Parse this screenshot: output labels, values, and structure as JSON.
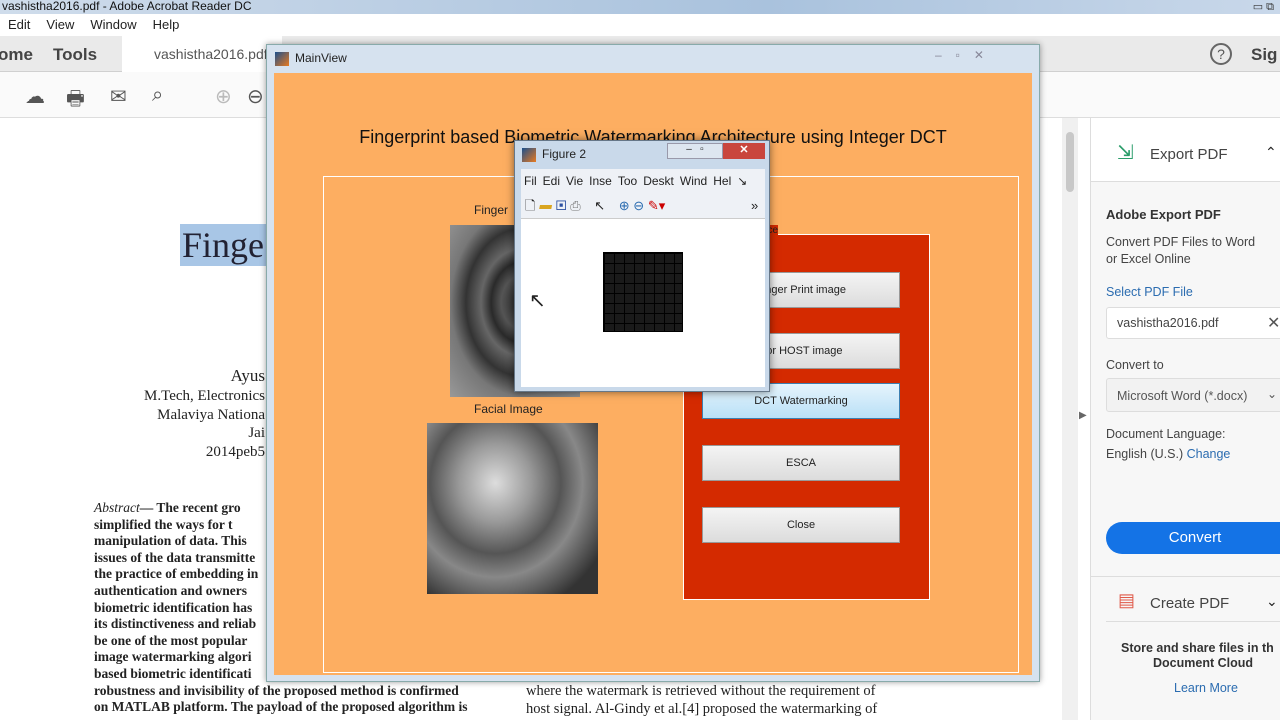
{
  "app": {
    "title": "vashistha2016.pdf - Adobe Acrobat Reader DC"
  },
  "menu": [
    "Edit",
    "View",
    "Window",
    "Help"
  ],
  "tabs": {
    "home": "ome",
    "tools": "Tools",
    "doc": "vashistha2016.pdf",
    "sign": "Sig"
  },
  "document": {
    "title_fragment": "Finge",
    "author_lines": [
      "Ayus",
      "M.Tech, Electronics",
      "Malaviya Nationa",
      "Jai",
      "2014peb5"
    ],
    "abstract_label": "Abstract",
    "abstract_lines": [
      "— The recent gro",
      "simplified the ways for t",
      "manipulation of data. This",
      "issues of the data transmitte",
      "the practice of embedding in",
      "authentication and owners",
      "biometric identification has",
      "its distinctiveness and reliab",
      "be one of the most popular",
      "image watermarking algori",
      "based biometric identificati",
      "robustness and invisibility of the proposed method is confirmed",
      "on MATLAB platform. The payload of the proposed algorithm is"
    ],
    "right_col_lines": [
      "where the watermark is retrieved without the requirement of",
      "host signal. Al-Gindy et al.[4] proposed the watermarking of"
    ]
  },
  "mainview": {
    "title": "MainView",
    "heading": "Fingerprint based Biometric Watermarking Architecture using Integer DCT",
    "fingerprint_label": "Finger",
    "facial_label": "Facial Image",
    "panel_label": "nce",
    "buttons": [
      "Finger Print image",
      "For HOST image",
      "DCT Watermarking",
      "ESCA",
      "Close"
    ]
  },
  "figure": {
    "title": "Figure 2",
    "menu": [
      "Fil",
      "Edi",
      "Vie",
      "Inse",
      "Too",
      "Deskt",
      "Wind",
      "Hel"
    ]
  },
  "right_panel": {
    "export_title": "Export PDF",
    "adobe_export": "Adobe Export PDF",
    "description_1": "Convert PDF Files to Word",
    "description_2": "or Excel Online",
    "select_file": "Select PDF File",
    "file": "vashistha2016.pdf",
    "convert_to": "Convert to",
    "format": "Microsoft Word (*.docx)",
    "lang_label": "Document Language:",
    "lang": "English (U.S.)",
    "change": "Change",
    "convert_btn": "Convert",
    "create_pdf": "Create PDF",
    "store_1": "Store and share files in th",
    "store_2": "Document Cloud",
    "learn_more": "Learn More"
  }
}
